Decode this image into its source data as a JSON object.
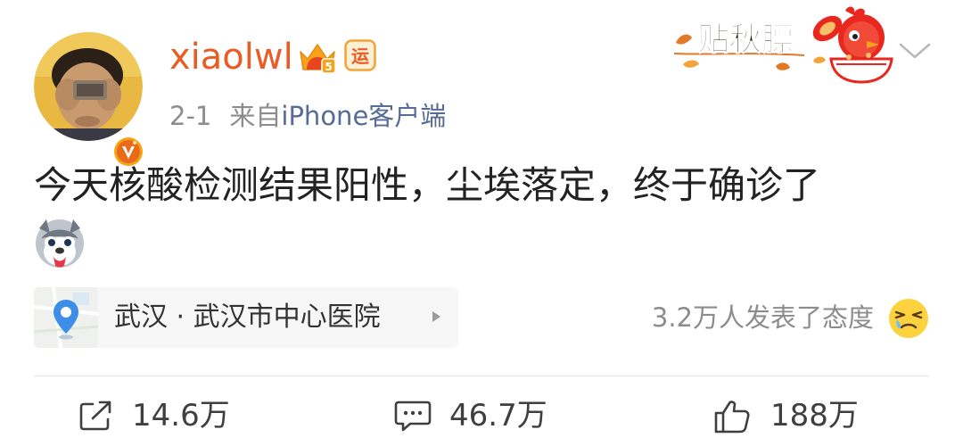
{
  "post": {
    "username": "xiaolwl",
    "date": "2-1",
    "source_prefix": "来自",
    "source_app": "iPhone客户端",
    "content": "今天核酸检测结果阳性，尘埃落定，终于确诊了",
    "sticker_text": "贴秋膘",
    "location": "武汉 · 武汉市中心医院",
    "reactions_text": "3.2万人发表了态度",
    "badges": {
      "vip_level": "5",
      "yun": "运"
    },
    "icons": {
      "verified": "verified-v-icon",
      "crown": "crown-badge-icon",
      "yun": "yun-badge-icon",
      "more": "chevron-down-icon",
      "location": "location-pin-icon",
      "arrow": "triangle-right-icon",
      "reaction": "tearful-face-emoji",
      "husky": "husky-emoji",
      "repost": "share-icon",
      "comment": "comment-icon",
      "like": "thumbs-up-icon"
    }
  },
  "actions": {
    "repost_count": "14.6万",
    "comment_count": "46.7万",
    "like_count": "188万"
  },
  "colors": {
    "username": "#ea5c23",
    "source_app": "#566b95",
    "meta": "#8c8c8c",
    "text": "#222222",
    "badge_gold": "#f5a623"
  }
}
